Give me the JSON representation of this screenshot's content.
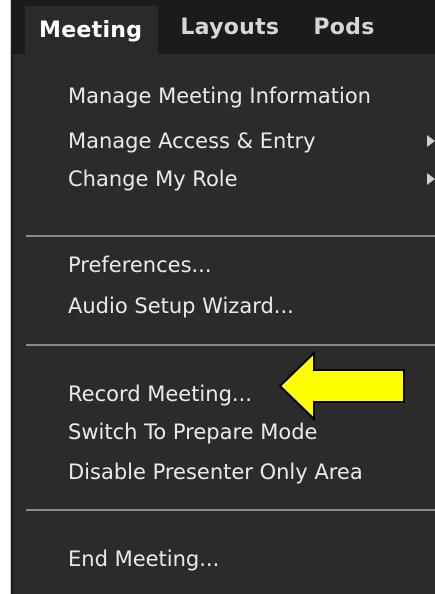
{
  "menubar": {
    "items": [
      {
        "label": "Meeting",
        "active": true
      },
      {
        "label": "Layouts",
        "active": false
      },
      {
        "label": "Pods",
        "active": false
      }
    ]
  },
  "dropdown": {
    "groups": [
      [
        {
          "label": "Manage Meeting Information",
          "has_submenu": false
        },
        {
          "label": "Manage Access & Entry",
          "has_submenu": true
        },
        {
          "label": "Change My Role",
          "has_submenu": true
        }
      ],
      [
        {
          "label": "Preferences...",
          "has_submenu": false
        },
        {
          "label": "Audio Setup Wizard...",
          "has_submenu": false
        }
      ],
      [
        {
          "label": "Record Meeting...",
          "has_submenu": false
        },
        {
          "label": "Switch To Prepare Mode",
          "has_submenu": false
        },
        {
          "label": "Disable Presenter Only Area",
          "has_submenu": false
        }
      ],
      [
        {
          "label": "End Meeting...",
          "has_submenu": false
        }
      ]
    ]
  },
  "annotation": {
    "icon": "arrow-left-icon",
    "fill": "#ffff00",
    "stroke": "#000000"
  },
  "colors": {
    "menubar_bg": "#1b1b1b",
    "active_tab_bg": "#2a2a2a",
    "dropdown_bg": "#2b2b2b",
    "text": "#e9e9e9",
    "separator": "#8a8a8a"
  }
}
